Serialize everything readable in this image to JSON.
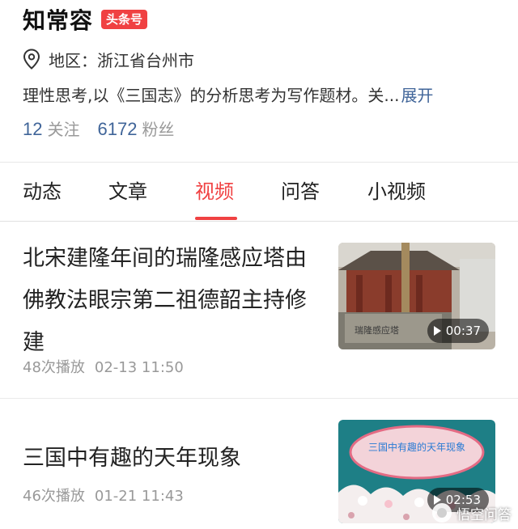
{
  "profile": {
    "name": "知常容",
    "badge": "头条号",
    "region": "地区：浙江省台州市",
    "bio": "理性思考,以《三国志》的分析思考为写作题材。关...",
    "bio_expand": "展开",
    "following_count": "12",
    "following_label": "关注",
    "followers_count": "6172",
    "followers_label": "粉丝"
  },
  "tabs": [
    {
      "label": "动态",
      "active": false
    },
    {
      "label": "文章",
      "active": false
    },
    {
      "label": "视频",
      "active": true
    },
    {
      "label": "问答",
      "active": false
    },
    {
      "label": "小视频",
      "active": false
    }
  ],
  "videos": [
    {
      "title": "北宋建隆年间的瑞隆感应塔由佛教法眼宗第二祖德韶主持修建",
      "plays": "48次播放",
      "time": "02-13 11:50",
      "duration": "00:37",
      "thumb_caption": "瑞隆感应塔"
    },
    {
      "title": "三国中有趣的天年现象",
      "plays": "46次播放",
      "time": "01-21 11:43",
      "duration": "02:53",
      "thumb_caption": "三国中有趣的天年现象"
    }
  ],
  "watermark": "悟空问答",
  "colors": {
    "accent": "#f04142",
    "link": "#406599",
    "muted": "#999999"
  }
}
